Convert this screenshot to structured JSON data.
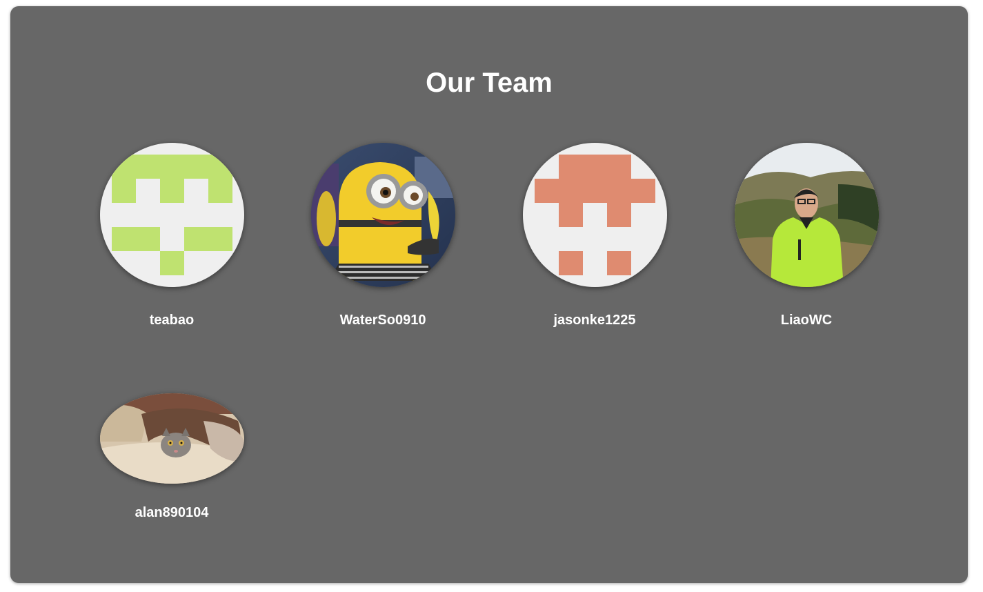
{
  "page": {
    "title": "Our Team",
    "background_color": "#676767",
    "text_color": "#ffffff"
  },
  "members": [
    {
      "name": "teabao",
      "avatar": "identicon",
      "avatar_color": "#bfe270"
    },
    {
      "name": "WaterSo0910",
      "avatar": "minion-photo"
    },
    {
      "name": "jasonke1225",
      "avatar": "identicon",
      "avatar_color": "#df8b70"
    },
    {
      "name": "LiaoWC",
      "avatar": "person-photo"
    },
    {
      "name": "alan890104",
      "avatar": "cat-photo"
    }
  ]
}
